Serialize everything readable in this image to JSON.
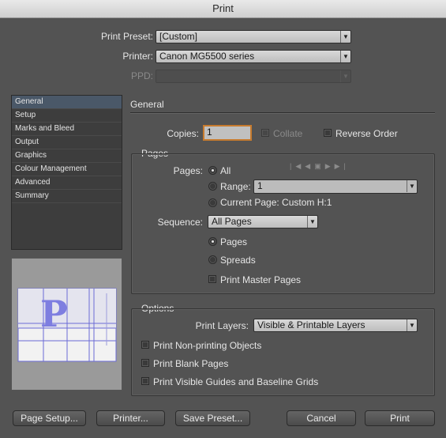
{
  "window": {
    "title": "Print"
  },
  "top": {
    "preset_label": "Print Preset:",
    "preset_value": "[Custom]",
    "printer_label": "Printer:",
    "printer_value": "Canon MG5500 series",
    "ppd_label": "PPD:",
    "ppd_value": ""
  },
  "sidebar": {
    "items": [
      {
        "label": "General",
        "selected": true
      },
      {
        "label": "Setup"
      },
      {
        "label": "Marks and Bleed"
      },
      {
        "label": "Output"
      },
      {
        "label": "Graphics"
      },
      {
        "label": "Colour Management"
      },
      {
        "label": "Advanced"
      },
      {
        "label": "Summary"
      }
    ]
  },
  "preview": {
    "glyph": "P"
  },
  "general": {
    "title": "General",
    "copies_label": "Copies:",
    "copies_value": "1",
    "collate_label": "Collate",
    "reverse_label": "Reverse Order"
  },
  "pages": {
    "title": "Pages",
    "pages_label": "Pages:",
    "all_label": "All",
    "range_label": "Range:",
    "range_value": "1",
    "current_label": "Current Page: Custom H:1",
    "sequence_label": "Sequence:",
    "sequence_value": "All Pages",
    "pages_option": "Pages",
    "spreads_option": "Spreads",
    "master_label": "Print Master Pages"
  },
  "options": {
    "title": "Options",
    "layers_label": "Print Layers:",
    "layers_value": "Visible & Printable Layers",
    "nonprinting_label": "Print Non-printing Objects",
    "blank_label": "Print Blank Pages",
    "guides_label": "Print Visible Guides and Baseline Grids"
  },
  "buttons": {
    "page_setup": "Page Setup...",
    "printer": "Printer...",
    "save_preset": "Save Preset...",
    "cancel": "Cancel",
    "print": "Print"
  }
}
